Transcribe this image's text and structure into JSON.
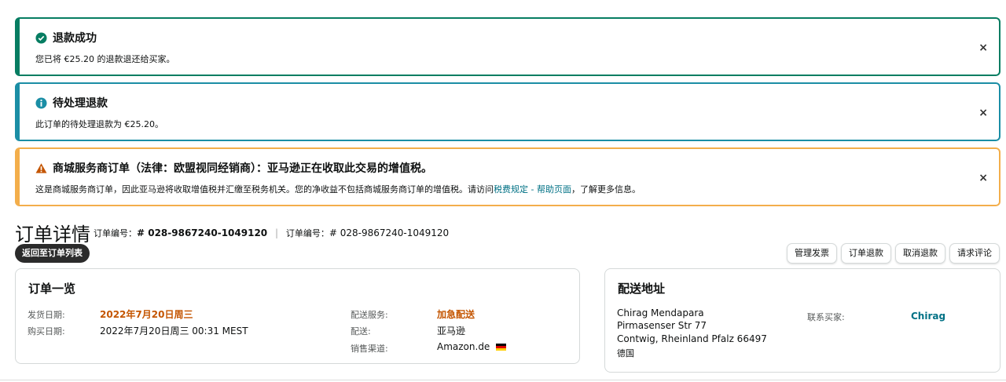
{
  "alerts": {
    "success": {
      "title": "退款成功",
      "body": "您已将 €25.20 的退款退还给买家。",
      "color": "#067d62"
    },
    "info": {
      "title": "待处理退款",
      "body": "此订单的待处理退款为 €25.20。",
      "color": "#1b8ea5"
    },
    "warning": {
      "title": "商城服务商订单（法律：欧盟视同经销商）：亚马逊正在收取此交易的增值税。",
      "body_prefix": "这是商城服务商订单，因此亚马逊将收取增值税并汇缴至税务机关。您的净收益不包括商城服务商订单的增值税。请访问",
      "body_link": "税费规定 - 帮助页面",
      "body_suffix": "，了解更多信息。",
      "color": "#f3ae4b"
    },
    "close_glyph": "×"
  },
  "header": {
    "title": "订单详情",
    "order_id_label_1": "订单编号：",
    "order_id_1": "# 028-9867240-1049120",
    "separator": "|",
    "order_id_label_2": "订单编号：",
    "order_id_2": "# 028-9867240-1049120",
    "back_label": "返回至订单列表"
  },
  "actions": [
    "管理发票",
    "订单退款",
    "取消退款",
    "请求评论"
  ],
  "overview": {
    "title": "订单一览",
    "ship_date_label": "发货日期:",
    "ship_date": "2022年7月20日周三",
    "purchase_date_label": "购买日期:",
    "purchase_date": "2022年7月20日周三 00:31 MEST",
    "shipping_service_label": "配送服务:",
    "shipping_service": "加急配送",
    "fulfillment_label": "配送:",
    "fulfillment": "亚马逊",
    "sales_channel_label": "销售渠道:",
    "sales_channel": "Amazon.de"
  },
  "address": {
    "title": "配送地址",
    "line1": "Chirag Mendapara",
    "line2": "Pirmasenser Str 77",
    "line3": "Contwig, Rheinland Pfalz 66497",
    "line4": "德国",
    "contact_label": "联系买家:",
    "contact_name": "Chirag"
  }
}
